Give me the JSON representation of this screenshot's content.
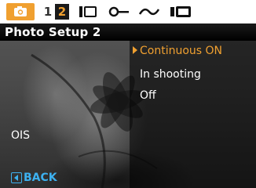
{
  "tabs": {
    "camera_icon": "camera-icon",
    "tab1_label": "1",
    "tab2_label": "2",
    "icons": [
      "movie-icon",
      "key-icon",
      "curve-icon",
      "playback-icon"
    ]
  },
  "header": {
    "title": "Photo Setup 2"
  },
  "options": [
    {
      "label": "Continuous ON",
      "selected": true
    },
    {
      "label": "In shooting",
      "selected": false
    },
    {
      "label": "Off",
      "selected": false
    }
  ],
  "setting": {
    "label": "OIS"
  },
  "footer": {
    "back_label": "BACK"
  },
  "colors": {
    "accent": "#f0a030",
    "back": "#3db1f0"
  }
}
